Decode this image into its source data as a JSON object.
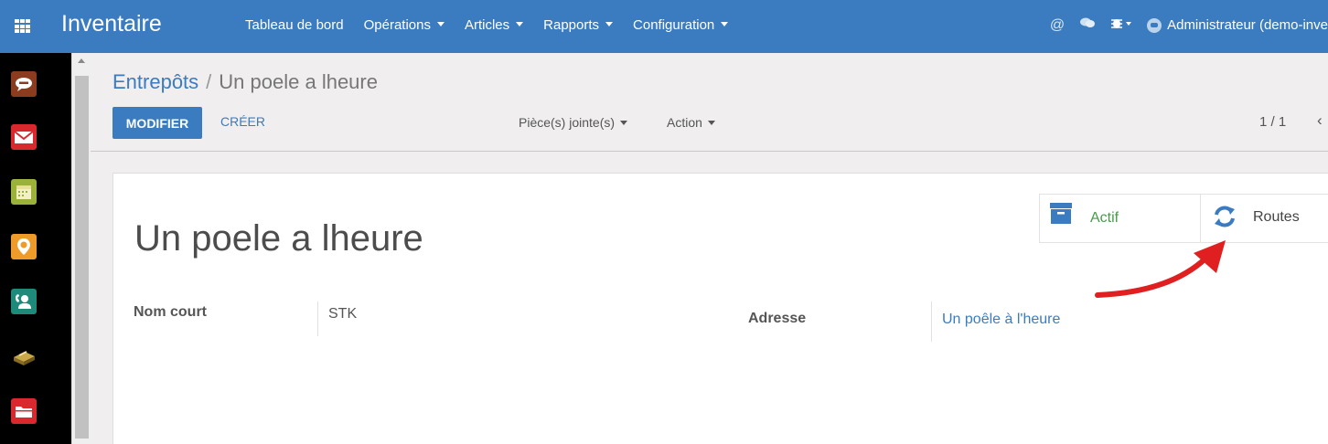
{
  "topbar": {
    "app_title": "Inventaire",
    "menu": [
      {
        "label": "Tableau de bord",
        "dropdown": false
      },
      {
        "label": "Opérations",
        "dropdown": true
      },
      {
        "label": "Articles",
        "dropdown": true
      },
      {
        "label": "Rapports",
        "dropdown": true
      },
      {
        "label": "Configuration",
        "dropdown": true
      }
    ],
    "user_name": "Administrateur (demo-inve",
    "icons": [
      "apps-grid-icon",
      "mention-icon",
      "chat-icon",
      "bug-icon",
      "user-avatar"
    ]
  },
  "sidebar": {
    "icons": [
      "discuss-icon",
      "mail-icon",
      "calendar-icon",
      "maps-icon",
      "contacts-icon",
      "stock-box-icon",
      "documents-icon"
    ]
  },
  "breadcrumb": {
    "parent": "Entrepôts",
    "separator": "/",
    "current": "Un poele a lheure"
  },
  "controlpanel": {
    "edit_label": "MODIFIER",
    "create_label": "CRÉER",
    "attachments_label": "Pièce(s) jointe(s)",
    "action_label": "Action",
    "pager": "1 / 1",
    "pager_prev": "‹"
  },
  "form": {
    "title": "Un poele a lheure",
    "smart_buttons": {
      "active_label": "Actif",
      "routes_label": "Routes"
    },
    "fields": {
      "short_name_label": "Nom court",
      "short_name_value": "STK",
      "address_label": "Adresse",
      "address_value": "Un poêle à l'heure"
    }
  },
  "colors": {
    "brand": "#3a7cbf",
    "annotation_arrow": "#e02020",
    "active_green": "#4a9a4a"
  }
}
